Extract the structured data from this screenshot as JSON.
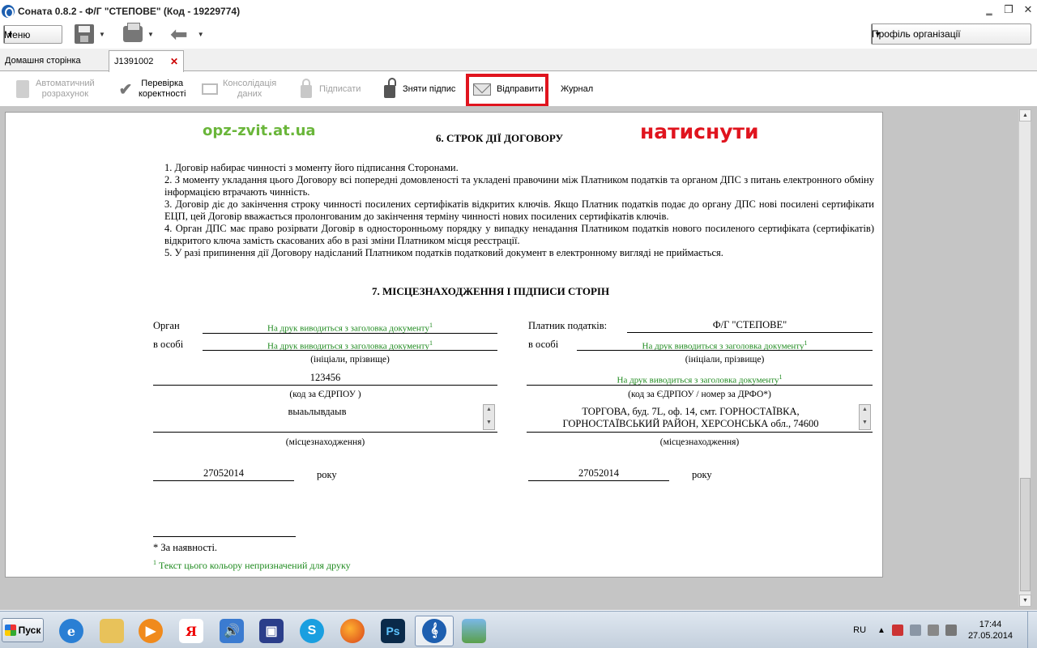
{
  "window": {
    "title": "Соната 0.8.2 - Ф/Г \"СТЕПОВЕ\" (Код - 19229774)"
  },
  "toolbar": {
    "menu_label": "Меню",
    "profile_label": "Профіль організації"
  },
  "tabs": {
    "home": "Домашня сторінка",
    "document": "J1391002",
    "close": "✕"
  },
  "doc_toolbar": {
    "auto_calc": [
      "Автоматичний",
      "розрахунок"
    ],
    "verify": [
      "Перевірка",
      "коректності"
    ],
    "consolidate": [
      "Консолідація",
      "даних"
    ],
    "sign": "Підписати",
    "unsign": "Зняти підпис",
    "send": "Відправити",
    "journal": "Журнал"
  },
  "annotation": {
    "watermark": "opz-zvit.at.ua",
    "instruction": "натиснути",
    "highlight_color": "#e0141e"
  },
  "document": {
    "section6_title": "6. СТРОК ДІЇ ДОГОВОРУ",
    "section6_paragraphs": [
      "1. Договір набирає чинності з моменту його підписання Сторонами.",
      "2. З моменту укладання цього Договору всі попередні домовленості та укладені правочини між Платником податків та органом ДПС з питань електронного обміну інформацією втрачають чинність.",
      "3. Договір діє до закінчення строку чинності посилених сертифікатів відкритих ключів. Якщо Платник податків подає до органу ДПС нові посилені сертифікати ЕЦП, цей Договір вважається пролонгованим до закінчення терміну чинності нових посилених сертифікатів ключів.",
      "4. Орган ДПС має право розірвати Договір в односторонньому порядку у випадку ненадання Платником податків нового посиленого сертифіката (сертифікатів) відкритого ключа замість скасованих або в разі зміни Платником місця реєстрації.",
      "5. У разі припинення дії Договору надісланий Платником податків податковий документ в електронному вигляді не приймається."
    ],
    "section7_title": "7. МІСЦЕЗНАХОДЖЕННЯ І ПІДПИСИ СТОРІН",
    "left": {
      "organ_label": "Орган",
      "organ_value": "На друк виводиться з заголовка документу",
      "person_label": "в особі",
      "person_value": "На друк виводиться з заголовка документу",
      "initials_caption": "(ініціали, прізвище)",
      "edrpou_value": "123456",
      "edrpou_caption": "(код за ЄДРПОУ )",
      "location_value": "выаьлывдаыв",
      "location_caption": "(місцезнаходження)",
      "date_value": "27052014",
      "year_label": "року"
    },
    "right": {
      "payer_label": "Платник податків:",
      "payer_value": "Ф/Г \"СТЕПОВЕ\"",
      "person_label": "в особі",
      "person_value": "На друк виводиться з заголовка документу",
      "initials_caption": "(ініціали, прізвище)",
      "code_value": "На друк виводиться з заголовка документу",
      "code_caption": "(код за ЄДРПОУ / номер за ДРФО*)",
      "location_line1": "ТОРГОВА, буд. 7L, оф. 14, смт. ГОРНОСТАЇВКА,",
      "location_line2": "ГОРНОСТАЇВСЬКИЙ РАЙОН, ХЕРСОНСЬКА обл., 74600",
      "location_caption": "(місцезнаходження)",
      "date_value": "27052014",
      "year_label": "року"
    },
    "sup_mark": "1",
    "footnote_star": "* За наявності.",
    "footnote_color_mark": "1",
    "footnote_color": "Текст цього кольору непризначений для друку"
  },
  "taskbar": {
    "start_label": "Пуск",
    "apps": [
      "internet-explorer",
      "file-explorer",
      "media-player",
      "yandex-browser",
      "volume-app",
      "save-app",
      "skype",
      "firefox",
      "photoshop",
      "sonata",
      "image-viewer"
    ],
    "language": "RU",
    "time": "17:44",
    "date": "27.05.2014"
  }
}
